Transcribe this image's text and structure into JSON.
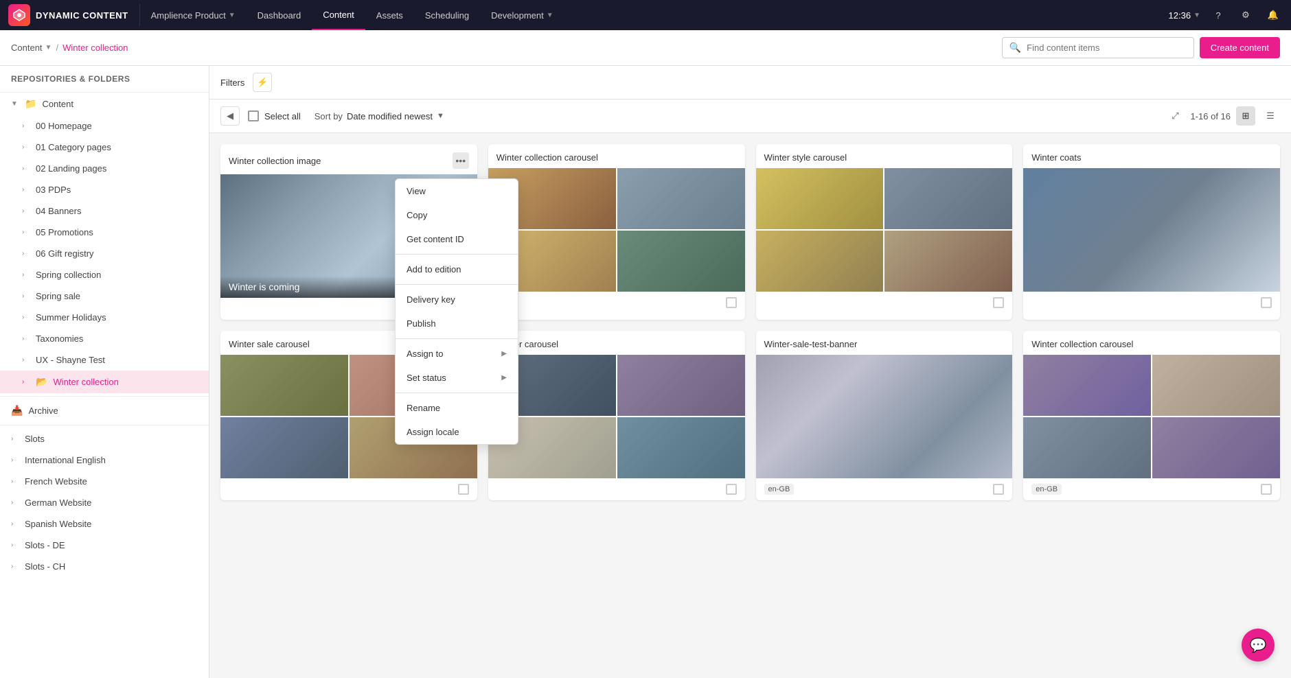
{
  "app": {
    "logo_text": "DYNAMIC CONTENT",
    "time": "12:36"
  },
  "nav": {
    "items": [
      {
        "label": "Amplience Product",
        "has_chevron": true,
        "active": false
      },
      {
        "label": "Dashboard",
        "has_chevron": false,
        "active": false
      },
      {
        "label": "Content",
        "has_chevron": false,
        "active": true
      },
      {
        "label": "Assets",
        "has_chevron": false,
        "active": false
      },
      {
        "label": "Scheduling",
        "has_chevron": false,
        "active": false
      },
      {
        "label": "Development",
        "has_chevron": true,
        "active": false
      }
    ]
  },
  "breadcrumb": {
    "root": "Content",
    "separator": "/",
    "current": "Winter collection"
  },
  "search": {
    "placeholder": "Find content items"
  },
  "create_btn": "Create content",
  "sidebar": {
    "header": "Repositories & folders",
    "sections": [
      {
        "label": "Content",
        "type": "expandable",
        "expanded": true,
        "level": 0
      },
      {
        "label": "00 Homepage",
        "type": "item",
        "level": 1
      },
      {
        "label": "01 Category pages",
        "type": "item",
        "level": 1
      },
      {
        "label": "02 Landing pages",
        "type": "item",
        "level": 1
      },
      {
        "label": "03 PDPs",
        "type": "item",
        "level": 1
      },
      {
        "label": "04 Banners",
        "type": "item",
        "level": 1
      },
      {
        "label": "05 Promotions",
        "type": "item",
        "level": 1
      },
      {
        "label": "06 Gift registry",
        "type": "item",
        "level": 1
      },
      {
        "label": "Spring collection",
        "type": "item",
        "level": 1
      },
      {
        "label": "Spring sale",
        "type": "item",
        "level": 1
      },
      {
        "label": "Summer Holidays",
        "type": "item",
        "level": 1
      },
      {
        "label": "Taxonomies",
        "type": "item",
        "level": 1
      },
      {
        "label": "UX - Shayne Test",
        "type": "item",
        "level": 1
      },
      {
        "label": "Winter collection",
        "type": "item",
        "level": 1,
        "active": true
      },
      {
        "label": "Archive",
        "type": "section",
        "level": 0
      },
      {
        "label": "Slots",
        "type": "expandable",
        "level": 0
      },
      {
        "label": "International English",
        "type": "item",
        "level": 0
      },
      {
        "label": "French Website",
        "type": "item",
        "level": 0
      },
      {
        "label": "German Website",
        "type": "item",
        "level": 0
      },
      {
        "label": "Spanish Website",
        "type": "item",
        "level": 0
      },
      {
        "label": "Slots - DE",
        "type": "item",
        "level": 0
      },
      {
        "label": "Slots - CH",
        "type": "item",
        "level": 0
      }
    ]
  },
  "toolbar": {
    "select_all": "Select all",
    "sort_by": "Sort by",
    "sort_value": "Date modified newest",
    "pagination": "1-16 of 16"
  },
  "context_menu": {
    "items": [
      {
        "label": "View",
        "has_sub": false
      },
      {
        "label": "Copy",
        "has_sub": false
      },
      {
        "label": "Get content ID",
        "has_sub": false
      },
      {
        "divider": true
      },
      {
        "label": "Add to edition",
        "has_sub": false
      },
      {
        "divider": true
      },
      {
        "label": "Delivery key",
        "has_sub": false
      },
      {
        "label": "Publish",
        "has_sub": false
      },
      {
        "divider": true
      },
      {
        "label": "Assign to",
        "has_sub": true
      },
      {
        "label": "Set status",
        "has_sub": true
      },
      {
        "divider": true
      },
      {
        "label": "Rename",
        "has_sub": false
      },
      {
        "label": "Assign locale",
        "has_sub": false
      }
    ]
  },
  "cards": [
    {
      "title": "Winter collection image",
      "type": "single",
      "overlay_text": "Winter is coming",
      "badge": null,
      "has_menu": true
    },
    {
      "title": "Winter collection carousel",
      "type": "grid",
      "badge": null,
      "has_menu": false
    },
    {
      "title": "Winter style carousel",
      "type": "grid",
      "badge": null,
      "has_menu": false
    },
    {
      "title": "Winter coats",
      "type": "single_tall",
      "badge": null,
      "has_menu": false
    },
    {
      "title": "Winter sale carousel",
      "type": "grid",
      "badge": null,
      "has_menu": false
    },
    {
      "title": "Winter carousel",
      "type": "grid",
      "badge": null,
      "has_menu": false
    },
    {
      "title": "Winter-sale-test-banner",
      "type": "single_tall",
      "badge": "en-GB",
      "has_menu": false
    },
    {
      "title": "Winter collection carousel",
      "type": "grid",
      "badge": "en-GB",
      "has_menu": false
    }
  ]
}
